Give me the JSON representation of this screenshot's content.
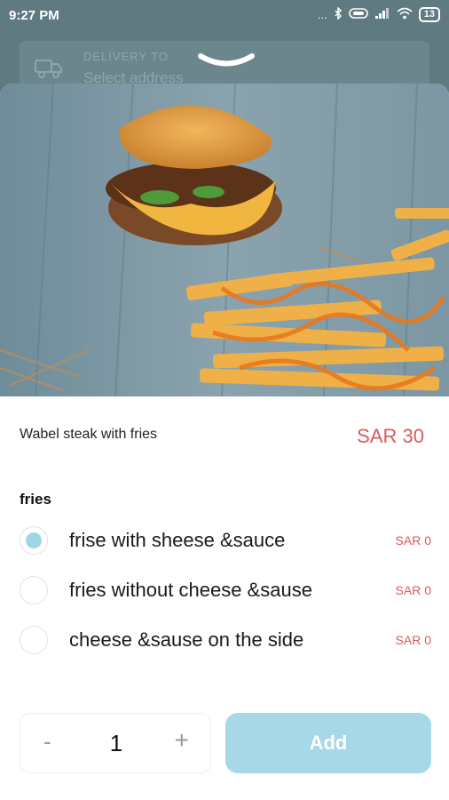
{
  "status_bar": {
    "time": "9:27 PM",
    "dots": "...",
    "battery": "13"
  },
  "delivery": {
    "label": "DELIVERY TO",
    "value": "Select address"
  },
  "item": {
    "name": "Wabel steak with fries",
    "price": "SAR 30"
  },
  "options_group": {
    "title": "fries",
    "options": [
      {
        "label": "frise with sheese &sauce",
        "price": "SAR 0",
        "selected": true
      },
      {
        "label": "fries without cheese &sause",
        "price": "SAR 0",
        "selected": false
      },
      {
        "label": "cheese &sause on the side",
        "price": "SAR 0",
        "selected": false
      }
    ]
  },
  "quantity": {
    "minus": "-",
    "value": "1",
    "plus": "+"
  },
  "add_button": {
    "label": "Add"
  },
  "colors": {
    "price_red": "#d85a5a",
    "accent_blue": "#a6d8e7",
    "backdrop": "#5f7a81"
  },
  "icons": [
    "bluetooth-icon",
    "signal-icon",
    "wifi-icon",
    "battery-icon",
    "truck-icon",
    "chevron-down-icon"
  ]
}
